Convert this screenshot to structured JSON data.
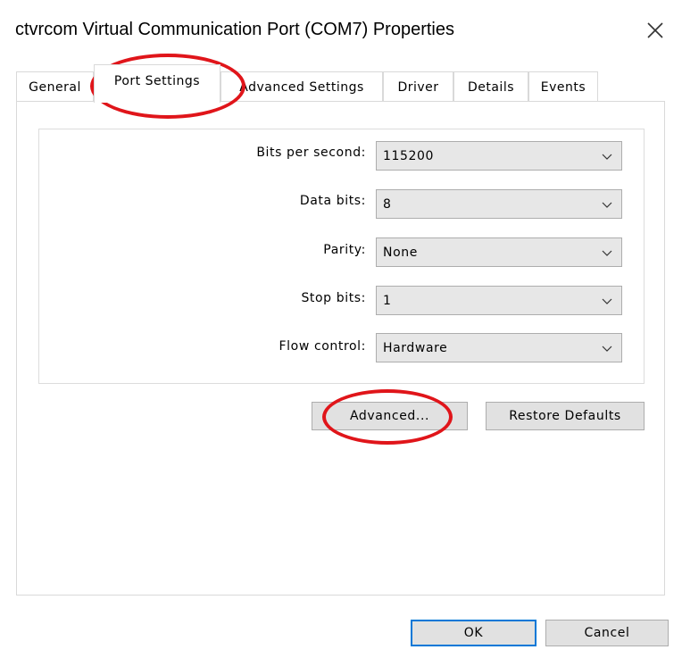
{
  "window": {
    "title": "ctvrcom Virtual Communication Port (COM7) Properties",
    "close_icon": "close-icon"
  },
  "tabs": [
    {
      "label": "General"
    },
    {
      "label": "Port Settings",
      "active": true
    },
    {
      "label": "Advanced Settings"
    },
    {
      "label": "Driver"
    },
    {
      "label": "Details"
    },
    {
      "label": "Events"
    }
  ],
  "settings": {
    "bits_per_second": {
      "label": "Bits per second:",
      "value": "115200"
    },
    "data_bits": {
      "label": "Data bits:",
      "value": "8"
    },
    "parity": {
      "label": "Parity:",
      "value": "None"
    },
    "stop_bits": {
      "label": "Stop bits:",
      "value": "1"
    },
    "flow_control": {
      "label": "Flow control:",
      "value": "Hardware"
    }
  },
  "actions": {
    "advanced_label": "Advanced...",
    "restore_defaults_label": "Restore Defaults"
  },
  "footer": {
    "ok_label": "OK",
    "cancel_label": "Cancel"
  },
  "colors": {
    "annotation": "#e0151a",
    "default_button_border": "#0078d7"
  }
}
